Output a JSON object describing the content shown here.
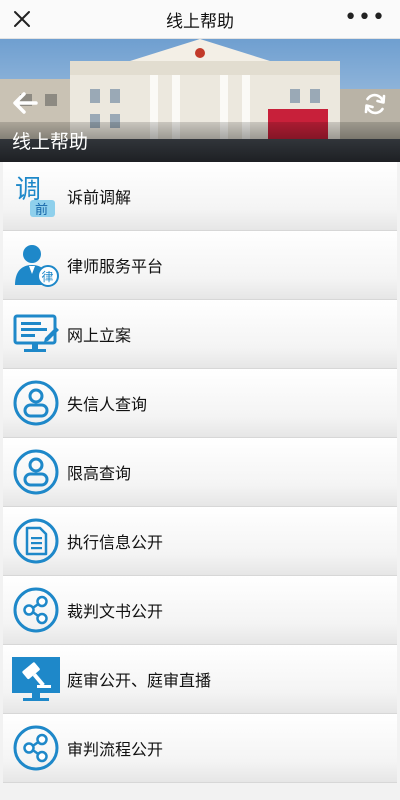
{
  "header": {
    "title": "线上帮助"
  },
  "banner": {
    "caption": "线上帮助"
  },
  "menu": [
    {
      "label": "诉前调解",
      "icon": "mediation-icon",
      "icon_text": [
        "调",
        "前"
      ]
    },
    {
      "label": "律师服务平台",
      "icon": "lawyer-icon",
      "icon_text": [
        "律"
      ]
    },
    {
      "label": "网上立案",
      "icon": "online-filing-icon"
    },
    {
      "label": "失信人查询",
      "icon": "person-circle-icon"
    },
    {
      "label": "限高查询",
      "icon": "person-circle-icon"
    },
    {
      "label": "执行信息公开",
      "icon": "document-circle-icon"
    },
    {
      "label": "裁判文书公开",
      "icon": "share-circle-icon"
    },
    {
      "label": "庭审公开、庭审直播",
      "icon": "gavel-icon"
    },
    {
      "label": "审判流程公开",
      "icon": "share-circle-icon"
    }
  ],
  "colors": {
    "accent": "#1e88c9",
    "accent_dark": "#1565a8"
  }
}
